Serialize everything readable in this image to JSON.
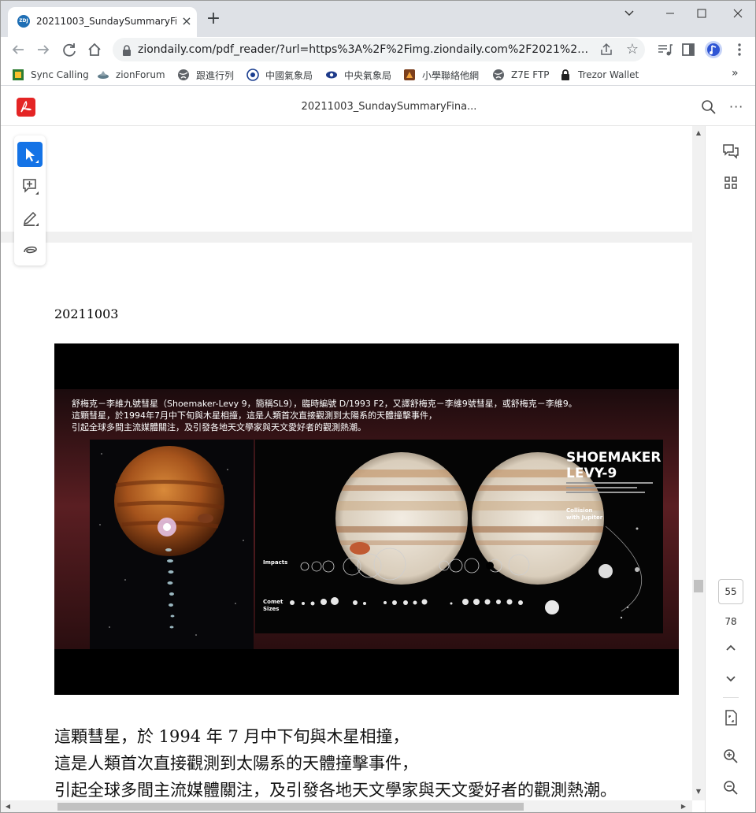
{
  "browser": {
    "tab_title": "20211003_SundaySummaryFin",
    "tab_favicon_text": "ZDJ",
    "url": "ziondaily.com/pdf_reader/?url=https%3A%2F%2Fimg.ziondaily.com%2F2021%2F10%...",
    "icons": [
      "back-icon",
      "forward-icon",
      "reload-icon",
      "home-icon",
      "lock-icon",
      "share-icon",
      "star-icon",
      "media-icon",
      "sidepanel-icon",
      "profile-icon",
      "menu-icon"
    ]
  },
  "bookmarks": [
    {
      "label": "Sync Calling",
      "icon": "sync-calling-icon"
    },
    {
      "label": "zionForum",
      "icon": "forum-icon"
    },
    {
      "label": "跟進行列",
      "icon": "globe-icon"
    },
    {
      "label": "中國氣象局",
      "icon": "cma-icon"
    },
    {
      "label": "中央氣象局",
      "icon": "cwb-icon"
    },
    {
      "label": "小學聯絡他網",
      "icon": "school-icon"
    },
    {
      "label": "Z7E FTP",
      "icon": "globe-icon"
    },
    {
      "label": "Trezor Wallet",
      "icon": "lock-icon"
    }
  ],
  "viewer": {
    "doc_title": "20211003_SundaySummaryFina...",
    "current_page": "55",
    "total_pages": "78"
  },
  "document": {
    "date": "20211003",
    "poster": {
      "caption_lines": [
        "舒梅克－李維九號彗星（Shoemaker-Levy 9，簡稱SL9），臨時編號 D/1993 F2，又譯舒梅克－李維9號彗星，或舒梅克－李維9。",
        "這顆彗星，於1994年7月中下旬與木星相撞，這是人類首次直接觀測到太陽系的天體撞擊事件，",
        "引起全球多間主流媒體關注，及引發各地天文學家與天文愛好者的觀測熱潮。"
      ],
      "title_line1": "SHOEMAKER",
      "title_line2": "LEVY-9",
      "collision_label_line1": "Collision",
      "collision_label_line2": "with Jupiter",
      "impacts_label": "Impacts",
      "comet_label_line1": "Comet",
      "comet_label_line2": "Sizes"
    },
    "paragraph_lines": [
      "這顆彗星，於 1994 年 7 月中下旬與木星相撞，",
      "這是人類首次直接觀測到太陽系的天體撞擊事件，",
      "引起全球多間主流媒體關注，及引發各地天文學家與天文愛好者的觀測熱潮。"
    ]
  },
  "colors": {
    "acrobat_red": "#e42525",
    "select_tool_blue": "#1473e6"
  }
}
